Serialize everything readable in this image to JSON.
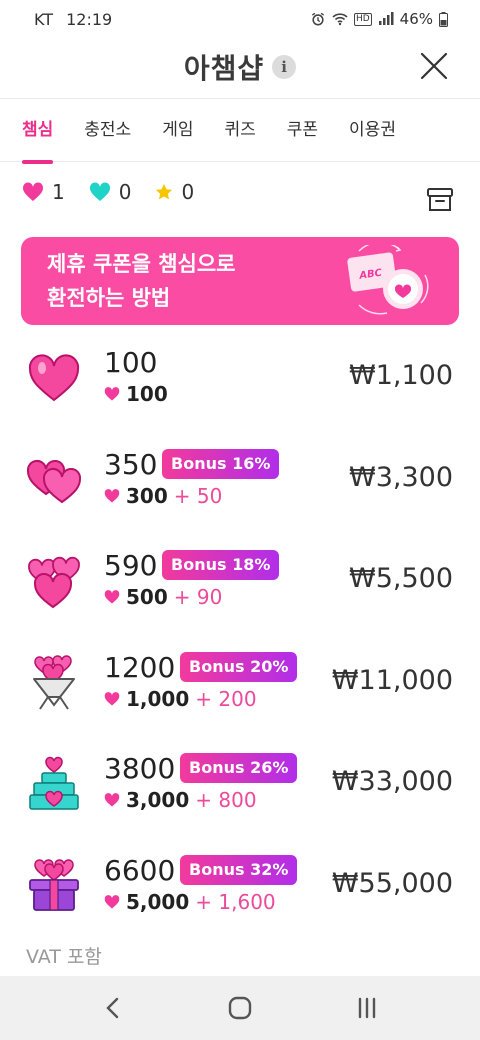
{
  "status_bar": {
    "carrier": "KT",
    "time": "12:19",
    "battery": "46%",
    "hd_label": "HD"
  },
  "header": {
    "title": "아챔샵",
    "info_glyph": "i"
  },
  "tabs": [
    {
      "label": "챔심",
      "active": true
    },
    {
      "label": "충전소",
      "active": false
    },
    {
      "label": "게임",
      "active": false
    },
    {
      "label": "퀴즈",
      "active": false
    },
    {
      "label": "쿠폰",
      "active": false
    },
    {
      "label": "이용권",
      "active": false
    }
  ],
  "balances": {
    "pink_heart": "1",
    "teal_heart": "0",
    "star": "0"
  },
  "banner": {
    "line1": "제휴 쿠폰을 챔심으로",
    "line2": "환전하는 방법",
    "art_label": "ABC"
  },
  "products": [
    {
      "amount": "100",
      "bonus": "",
      "base": "100",
      "extra": "",
      "price": "₩1,100"
    },
    {
      "amount": "350",
      "bonus": "Bonus 16%",
      "base": "300",
      "extra": "+ 50",
      "price": "₩3,300"
    },
    {
      "amount": "590",
      "bonus": "Bonus 18%",
      "base": "500",
      "extra": "+ 90",
      "price": "₩5,500"
    },
    {
      "amount": "1200",
      "bonus": "Bonus 20%",
      "base": "1,000",
      "extra": "+ 200",
      "price": "₩11,000"
    },
    {
      "amount": "3800",
      "bonus": "Bonus 26%",
      "base": "3,000",
      "extra": "+ 800",
      "price": "₩33,000"
    },
    {
      "amount": "6600",
      "bonus": "Bonus 32%",
      "base": "5,000",
      "extra": "+ 1,600",
      "price": "₩55,000"
    }
  ],
  "footer_note": "VAT 포함",
  "colors": {
    "accent": "#ec2d8c",
    "banner": "#fb4ca3",
    "bonus_start": "#f23a9c",
    "bonus_end": "#b12ee9",
    "teal": "#1fd3c6",
    "star": "#f7c600"
  }
}
